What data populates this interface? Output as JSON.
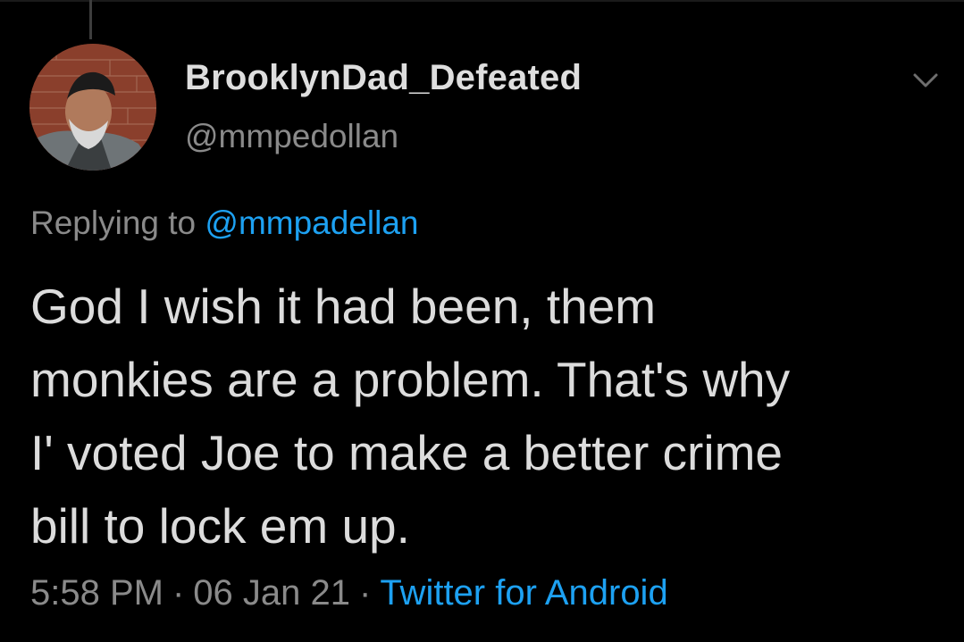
{
  "tweet": {
    "author": {
      "display_name": "BrooklynDad_Defeated",
      "handle": "@mmpedollan"
    },
    "reply": {
      "prefix": "Replying to",
      "mention": "@mmpadellan"
    },
    "text_lines": [
      "God I wish it had been, them",
      "monkies are a problem. That's why",
      "I' voted Joe to make a better crime",
      "bill to lock em up."
    ],
    "meta": {
      "time": "5:58 PM",
      "separator": "·",
      "date": "06 Jan 21",
      "source": "Twitter for Android"
    }
  },
  "icons": {
    "menu": "chevron-down-icon",
    "avatar": "avatar"
  },
  "colors": {
    "background": "#000000",
    "text_primary": "#dcdcdc",
    "text_secondary": "#8a8a8a",
    "link": "#1da1f2"
  }
}
